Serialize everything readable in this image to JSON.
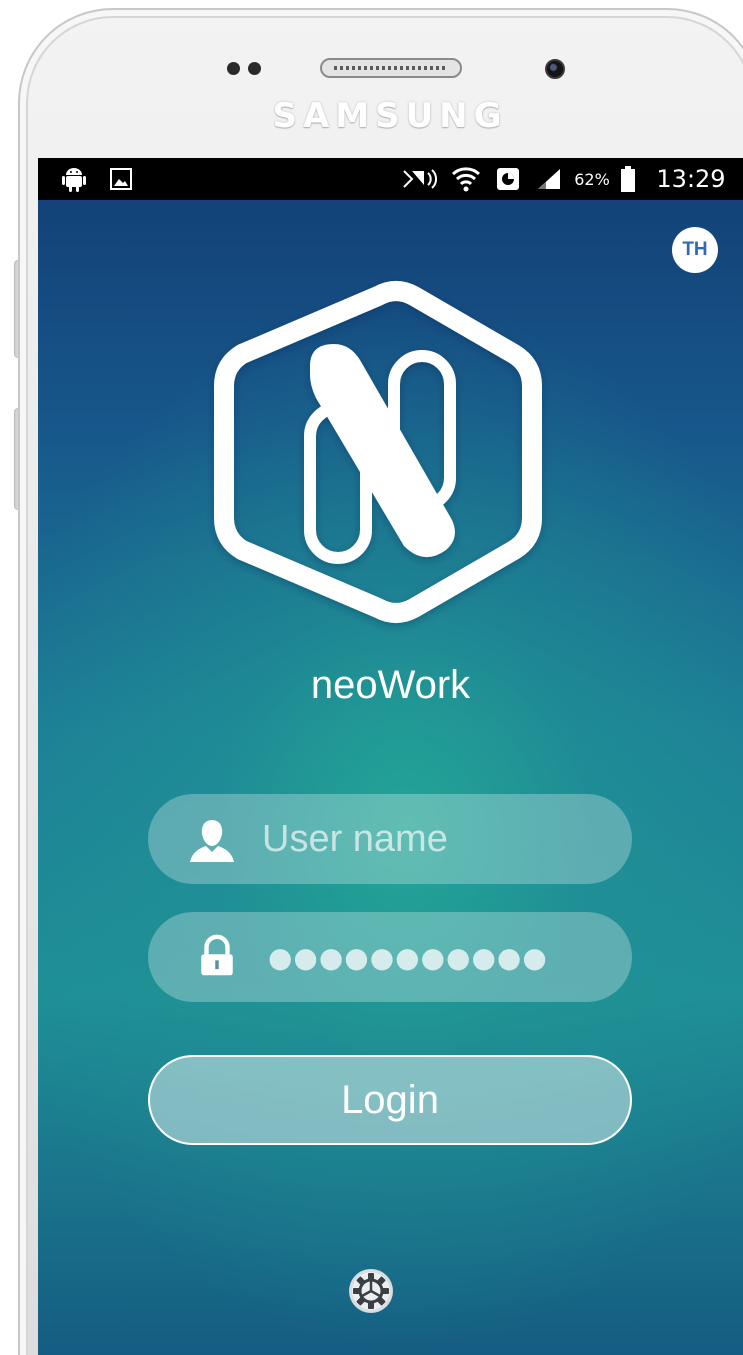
{
  "device": {
    "brand": "SAMSUNG"
  },
  "status_bar": {
    "battery": "62%",
    "time": "13:29",
    "left_icons": [
      "android-icon",
      "image-notification-icon"
    ],
    "right_icons": [
      "nfc-icon",
      "wifi-icon",
      "data-saver-icon",
      "signal-icon",
      "battery-icon"
    ]
  },
  "app": {
    "language_badge": "TH",
    "logo_icon": "neowork-n-hexagon-logo",
    "name": "neoWork"
  },
  "login_form": {
    "username": {
      "placeholder": "User name",
      "value": "",
      "icon": "user-icon"
    },
    "password": {
      "masked_value": "●●●●●●●●●●●",
      "icon": "lock-icon"
    },
    "login_label": "Login",
    "settings_icon": "gear-icon"
  },
  "colors": {
    "background_top": "#123f74",
    "background_center": "#23a596",
    "background_bottom": "#155c82",
    "badge_text": "#2f6bb5"
  }
}
